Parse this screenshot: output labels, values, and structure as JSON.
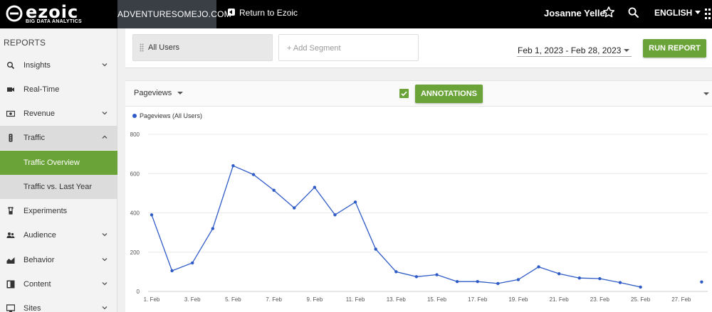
{
  "app": {
    "logo_text": "ezoic",
    "logo_tagline": "BIG DATA ANALYTICS",
    "site_name": "ADVENTURESOMEJO.COM",
    "return_label": "Return to Ezoic",
    "user_name": "Josanne Yelle",
    "language": "ENGLISH"
  },
  "sidebar": {
    "heading": "REPORTS",
    "items": [
      {
        "label": "Insights",
        "icon": "search-icon",
        "chevron": "down"
      },
      {
        "label": "Real-Time",
        "icon": "video-icon",
        "chevron": ""
      },
      {
        "label": "Revenue",
        "icon": "money-icon",
        "chevron": "down"
      },
      {
        "label": "Traffic",
        "icon": "traffic-light-icon",
        "chevron": "up"
      },
      {
        "label": "Traffic Overview",
        "icon": "",
        "chevron": ""
      },
      {
        "label": "Traffic vs. Last Year",
        "icon": "",
        "chevron": ""
      },
      {
        "label": "Experiments",
        "icon": "flask-icon",
        "chevron": ""
      },
      {
        "label": "Audience",
        "icon": "people-icon",
        "chevron": "down"
      },
      {
        "label": "Behavior",
        "icon": "area-chart-icon",
        "chevron": "down"
      },
      {
        "label": "Content",
        "icon": "content-icon",
        "chevron": "down"
      },
      {
        "label": "Sites",
        "icon": "sites-icon",
        "chevron": "down"
      }
    ]
  },
  "segments": {
    "current": "All Users",
    "add_placeholder": "+ Add Segment"
  },
  "date_range": "Feb 1, 2023 - Feb 28, 2023",
  "run_report_label": "RUN REPORT",
  "chart_controls": {
    "metric": "Pageviews",
    "annotations_label": "ANNOTATIONS",
    "annotations_checked": true
  },
  "colors": {
    "brand_green": "#6aa338",
    "series_blue": "#2f5bc7",
    "topbar": "#000000"
  },
  "chart_data": {
    "type": "line",
    "legend": [
      "Pageviews (All Users)"
    ],
    "legend_position": "top-left",
    "grid": true,
    "ylim": [
      0,
      800
    ],
    "yticks": [
      0,
      200,
      400,
      600,
      800
    ],
    "xtick_labels": [
      "1. Feb",
      "3. Feb",
      "5. Feb",
      "7. Feb",
      "9. Feb",
      "11. Feb",
      "13. Feb",
      "15. Feb",
      "17. Feb",
      "19. Feb",
      "21. Feb",
      "23. Feb",
      "25. Feb",
      "27. Feb"
    ],
    "series": [
      {
        "name": "Pageviews (All Users)",
        "x": [
          1,
          2,
          3,
          4,
          5,
          6,
          7,
          8,
          9,
          10,
          11,
          12,
          13,
          14,
          15,
          16,
          17,
          18,
          19,
          20,
          21,
          22,
          23,
          24,
          25,
          26,
          27,
          28
        ],
        "values": [
          390,
          105,
          145,
          320,
          640,
          595,
          515,
          425,
          530,
          390,
          455,
          215,
          100,
          75,
          85,
          50,
          50,
          40,
          60,
          125,
          90,
          68,
          65,
          45,
          22,
          null,
          null,
          48
        ]
      }
    ]
  }
}
